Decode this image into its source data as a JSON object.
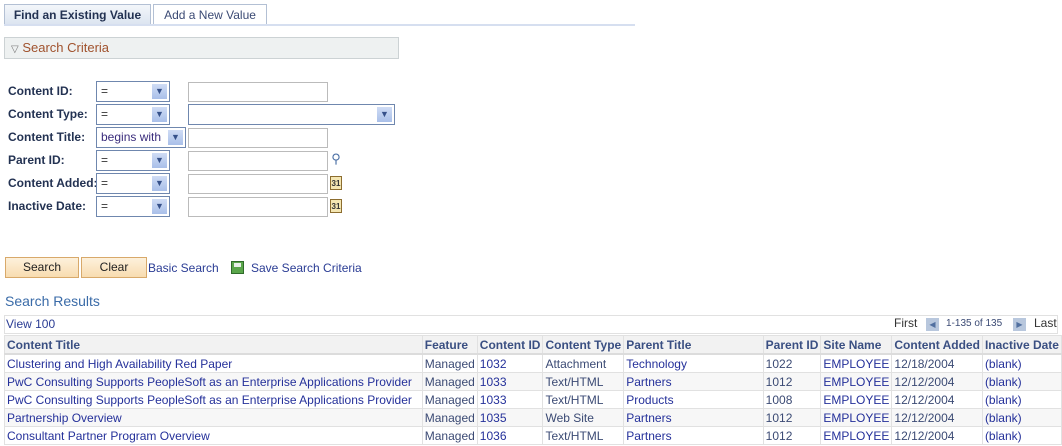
{
  "tabs": [
    {
      "label": "Find an Existing Value",
      "active": true
    },
    {
      "label": "Add a New Value",
      "active": false
    }
  ],
  "criteria": {
    "header": "Search Criteria",
    "fields": [
      {
        "label": "Content ID:",
        "operator": "=",
        "value": ""
      },
      {
        "label": "Content Type:",
        "operator": "=",
        "value": ""
      },
      {
        "label": "Content Title:",
        "operator": "begins with",
        "value": ""
      },
      {
        "label": "Parent ID:",
        "operator": "=",
        "value": "",
        "icon": "lookup-icon"
      },
      {
        "label": "Content Added:",
        "operator": "=",
        "value": "",
        "icon": "calendar-icon"
      },
      {
        "label": "Inactive Date:",
        "operator": "=",
        "value": "",
        "icon": "calendar-icon"
      }
    ],
    "calendar_icon_text": "31"
  },
  "actions": {
    "search": "Search",
    "clear": "Clear",
    "basic_search": "Basic Search",
    "save_criteria": "Save Search Criteria"
  },
  "results": {
    "title": "Search Results",
    "view_all": "View 100",
    "pager": {
      "first": "First",
      "range": "1-135 of 135",
      "last": "Last"
    },
    "columns": [
      "Content Title",
      "Feature",
      "Content ID",
      "Content Type",
      "Parent Title",
      "Parent ID",
      "Site Name",
      "Content Added",
      "Inactive Date"
    ],
    "rows": [
      [
        "Clustering and High Availability Red Paper",
        "Managed",
        "1032",
        "Attachment",
        "Technology",
        "1022",
        "EMPLOYEE",
        "12/18/2004",
        "(blank)"
      ],
      [
        "PwC Consulting Supports PeopleSoft as an Enterprise Applications Provider",
        "Managed",
        "1033",
        "Text/HTML",
        "Partners",
        "1012",
        "EMPLOYEE",
        "12/12/2004",
        "(blank)"
      ],
      [
        "PwC Consulting Supports PeopleSoft as an Enterprise Applications Provider",
        "Managed",
        "1033",
        "Text/HTML",
        "Products",
        "1008",
        "EMPLOYEE",
        "12/12/2004",
        "(blank)"
      ],
      [
        "Partnership Overview",
        "Managed",
        "1035",
        "Web Site",
        "Partners",
        "1012",
        "EMPLOYEE",
        "12/12/2004",
        "(blank)"
      ],
      [
        "Consultant Partner Program Overview",
        "Managed",
        "1036",
        "Text/HTML",
        "Partners",
        "1012",
        "EMPLOYEE",
        "12/12/2004",
        "(blank)"
      ]
    ]
  }
}
